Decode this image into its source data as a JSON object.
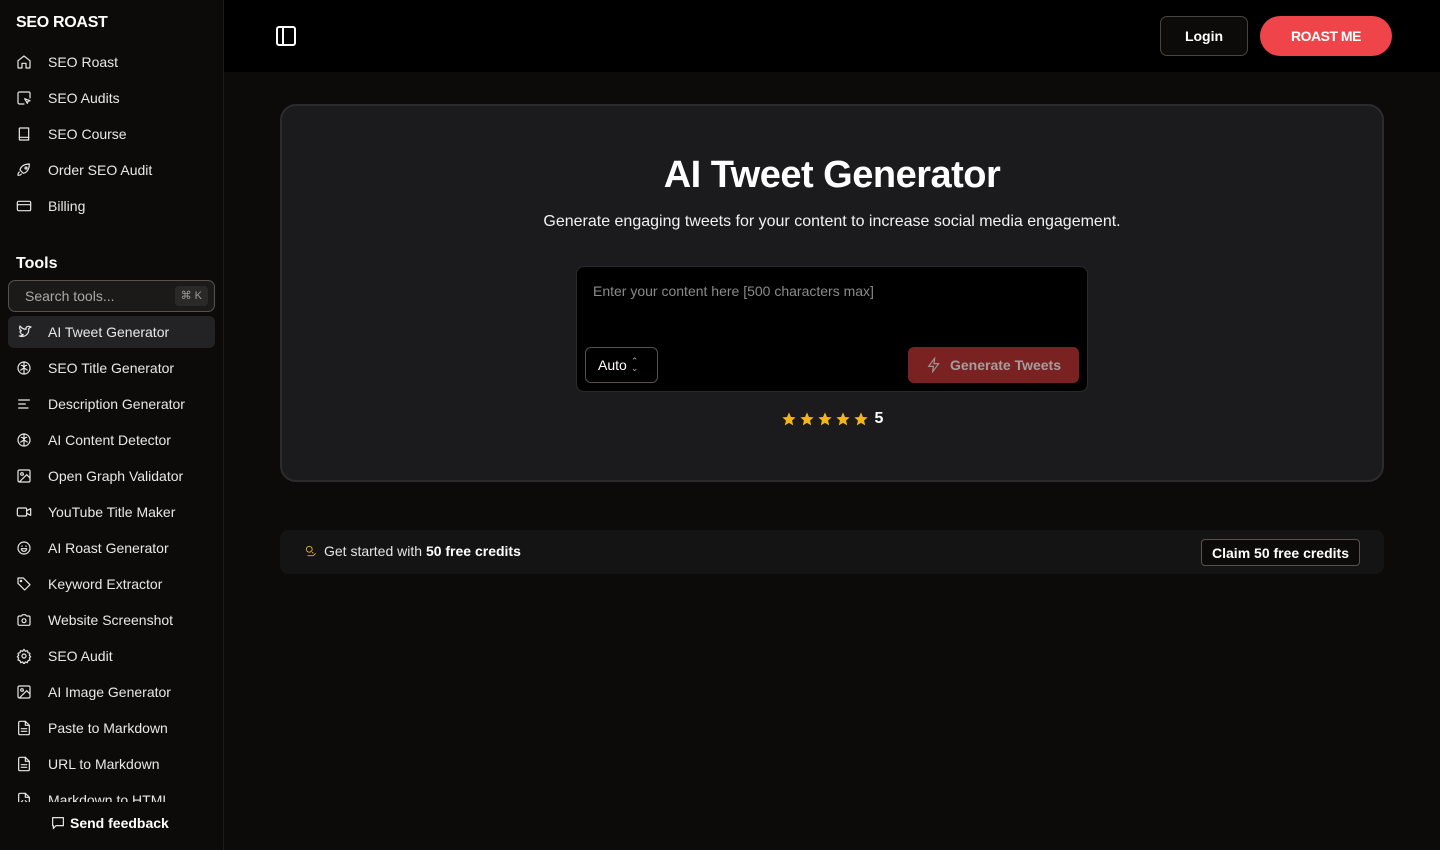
{
  "brand": "SEO ROAST",
  "sidebar": {
    "main_items": [
      {
        "label": "SEO Roast",
        "icon": "home-icon"
      },
      {
        "label": "SEO Audits",
        "icon": "cursor-square-icon"
      },
      {
        "label": "SEO Course",
        "icon": "book-icon"
      },
      {
        "label": "Order SEO Audit",
        "icon": "rocket-icon"
      },
      {
        "label": "Billing",
        "icon": "credit-card-icon"
      }
    ],
    "tools_title": "Tools",
    "search_placeholder": "Search tools...",
    "search_shortcut": "⌘ K",
    "tools": [
      {
        "label": "AI Tweet Generator",
        "icon": "twitter-icon",
        "active": true
      },
      {
        "label": "SEO Title Generator",
        "icon": "brain-icon"
      },
      {
        "label": "Description Generator",
        "icon": "align-left-icon"
      },
      {
        "label": "AI Content Detector",
        "icon": "brain-icon"
      },
      {
        "label": "Open Graph Validator",
        "icon": "image-icon"
      },
      {
        "label": "YouTube Title Maker",
        "icon": "video-icon"
      },
      {
        "label": "AI Roast Generator",
        "icon": "smile-icon"
      },
      {
        "label": "Keyword Extractor",
        "icon": "tag-icon"
      },
      {
        "label": "Website Screenshot",
        "icon": "camera-icon"
      },
      {
        "label": "SEO Audit",
        "icon": "gear-icon"
      },
      {
        "label": "AI Image Generator",
        "icon": "image-icon"
      },
      {
        "label": "Paste to Markdown",
        "icon": "file-text-icon"
      },
      {
        "label": "URL to Markdown",
        "icon": "file-text-icon"
      },
      {
        "label": "Markdown to HTML",
        "icon": "file-code-icon"
      }
    ],
    "feedback_label": "Send feedback"
  },
  "topbar": {
    "login_label": "Login",
    "roast_label": "ROAST ME"
  },
  "main": {
    "title": "AI Tweet Generator",
    "subtitle": "Generate engaging tweets for your content to increase social media engagement.",
    "input_placeholder": "Enter your content here [500 characters max]",
    "input_value": "",
    "select_value": "Auto",
    "generate_label": "Generate Tweets",
    "rating": {
      "stars": 5,
      "max": 5,
      "value_label": "5"
    }
  },
  "credits": {
    "prefix": "Get started with ",
    "highlight": "50 free credits",
    "claim_label": "Claim 50 free credits"
  },
  "colors": {
    "accent": "#ef4449",
    "generate_bg": "#7a2222",
    "star": "#f3b51b"
  }
}
